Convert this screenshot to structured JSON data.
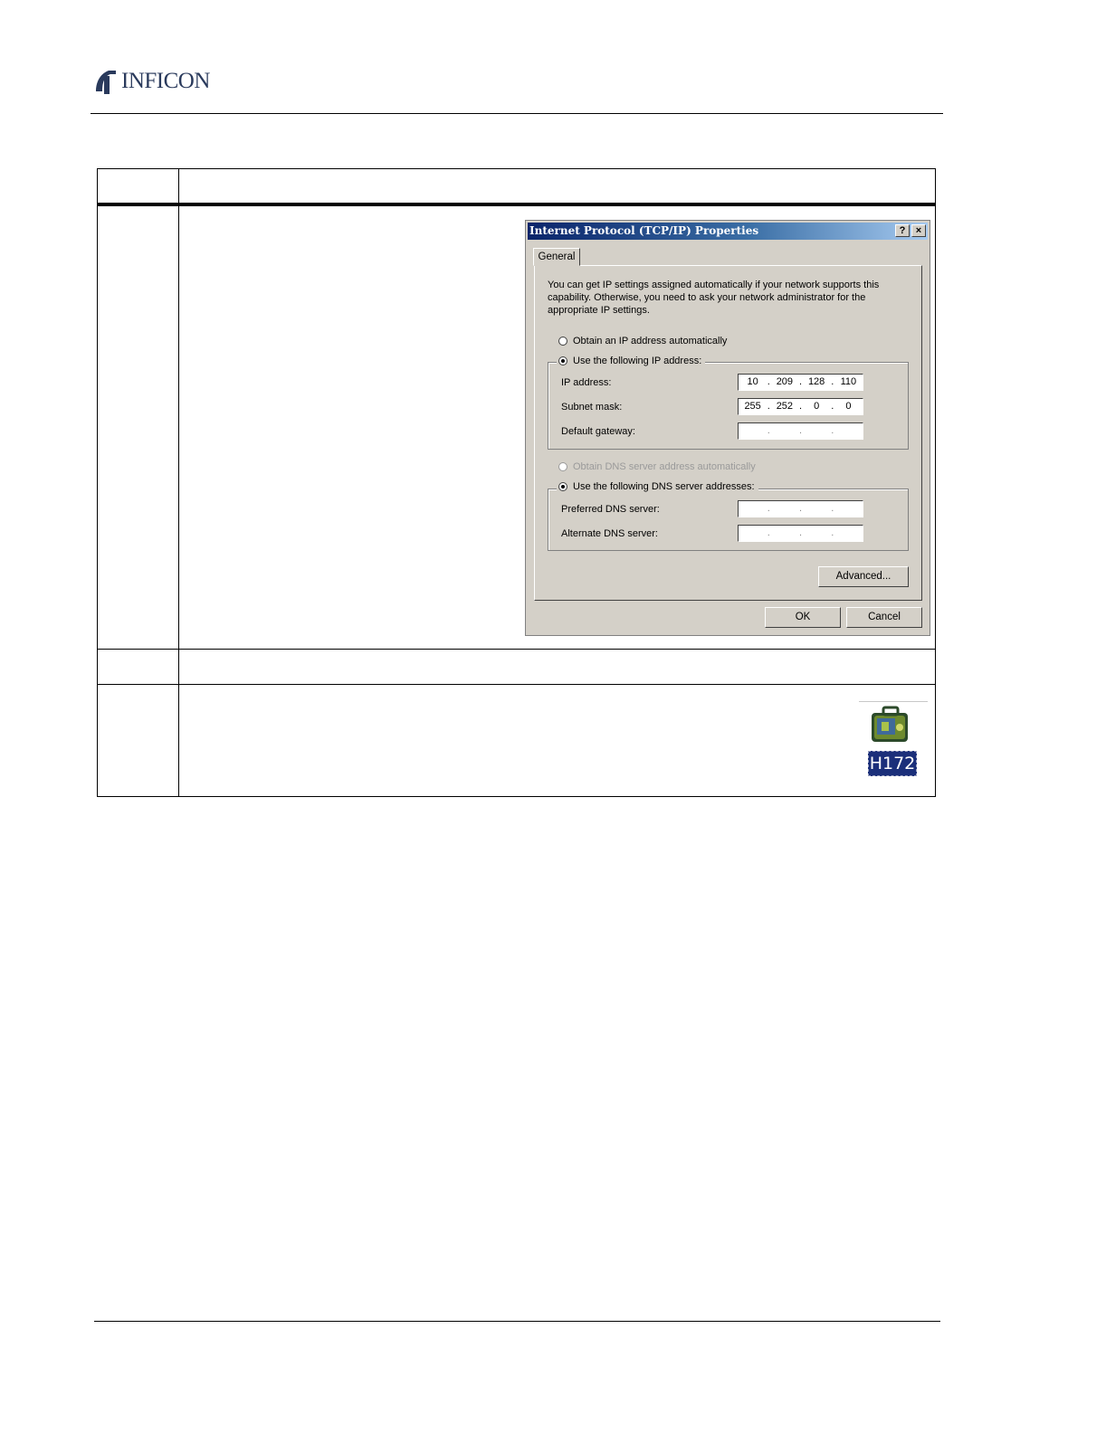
{
  "header": {
    "logo_text": "INFICON"
  },
  "dialog": {
    "title": "Internet Protocol (TCP/IP) Properties",
    "help_button": "?",
    "close_button": "×",
    "tab_general": "General",
    "intro_text": "You can get IP settings assigned automatically if your network supports this capability. Otherwise, you need to ask your network administrator for the appropriate IP settings.",
    "radio_ip_auto": "Obtain an IP address automatically",
    "radio_ip_manual": "Use the following IP address:",
    "ip_address_label": "IP address:",
    "ip_address": [
      "10",
      "209",
      "128",
      "110"
    ],
    "subnet_mask_label": "Subnet mask:",
    "subnet_mask": [
      "255",
      "252",
      "0",
      "0"
    ],
    "default_gateway_label": "Default gateway:",
    "radio_dns_auto": "Obtain DNS server address automatically",
    "radio_dns_manual": "Use the following DNS server addresses:",
    "preferred_dns_label": "Preferred DNS server:",
    "alternate_dns_label": "Alternate DNS server:",
    "advanced_button": "Advanced...",
    "ok_button": "OK",
    "cancel_button": "Cancel"
  },
  "icons": {
    "shortcut_label": "H172"
  }
}
